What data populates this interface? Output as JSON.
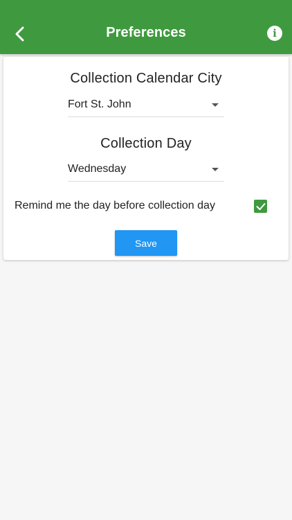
{
  "header": {
    "title": "Preferences",
    "back_icon": "chevron-left-icon",
    "info_icon": "info-icon",
    "background_color": "#3f9a3f"
  },
  "form": {
    "city_section_title": "Collection Calendar City",
    "city_selected": "Fort St. John",
    "day_section_title": "Collection Day",
    "day_selected": "Wednesday",
    "remind_label": "Remind me the day before collection day",
    "remind_checked": true,
    "save_label": "Save",
    "save_color": "#2196f3",
    "checkbox_color": "#3f9a3f"
  }
}
